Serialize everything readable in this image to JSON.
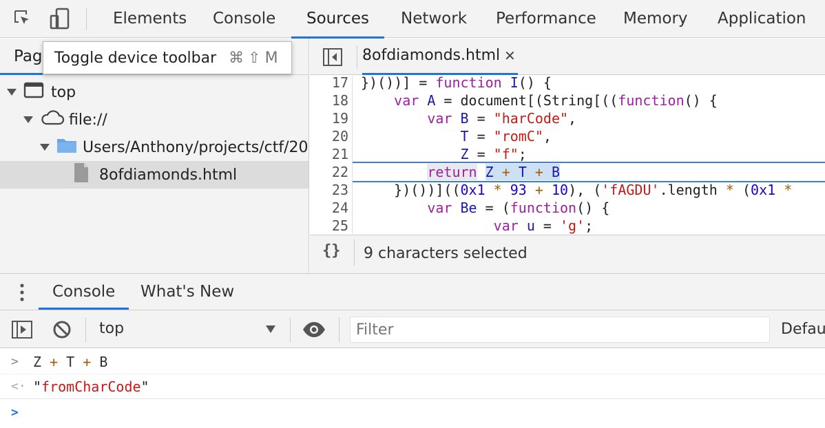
{
  "toolbar": {
    "tabs": [
      {
        "label": "Elements"
      },
      {
        "label": "Console"
      },
      {
        "label": "Sources"
      },
      {
        "label": "Network"
      },
      {
        "label": "Performance"
      },
      {
        "label": "Memory"
      },
      {
        "label": "Application"
      }
    ],
    "active_tab": "Sources"
  },
  "tooltip": {
    "text": "Toggle device toolbar",
    "shortcut": "⌘⇧M"
  },
  "navigator": {
    "tab_label": "Pag",
    "tree": [
      {
        "label": "top",
        "icon": "frame-icon"
      },
      {
        "label": "file://",
        "icon": "cloud-icon"
      },
      {
        "label": "Users/Anthony/projects/ctf/20",
        "icon": "folder-icon"
      },
      {
        "label": "8ofdiamonds.html",
        "icon": "file-icon",
        "selected": true
      }
    ]
  },
  "editor": {
    "file_tab": "8ofdiamonds.html",
    "line_numbers": [
      "17",
      "18",
      "19",
      "20",
      "21",
      "22",
      "23",
      "24",
      "25"
    ],
    "status": "9 characters selected",
    "status_icon": "pretty-print-icon"
  },
  "drawer": {
    "tabs": [
      {
        "label": "Console"
      },
      {
        "label": "What's New"
      }
    ],
    "context": "top",
    "filter_placeholder": "Filter",
    "levels_label": "Defau"
  },
  "console": {
    "input": "Z + T + B",
    "result": "\"fromCharCode\""
  },
  "colors": {
    "accent": "#1a73e8",
    "keyword": "#9e1ea1",
    "string": "#c41a16",
    "number": "#1c00cf",
    "identifier": "#1a1aa6",
    "selection": "#cde0f5"
  }
}
